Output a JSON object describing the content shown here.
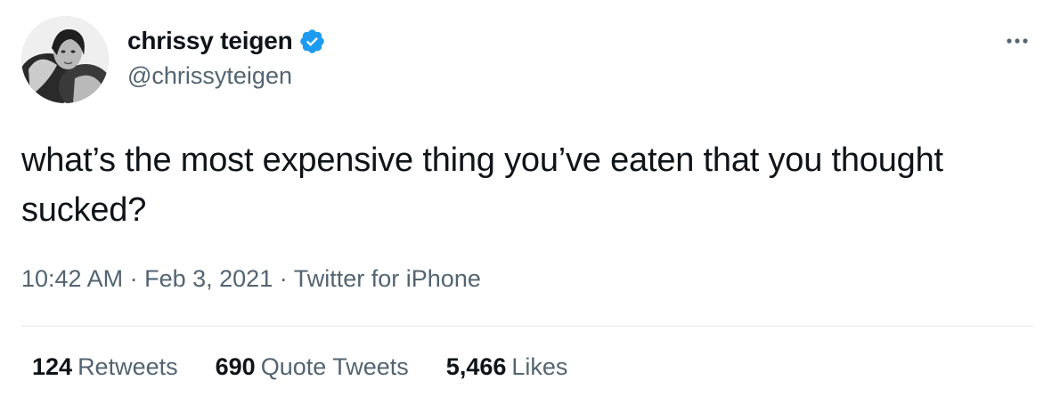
{
  "user": {
    "display_name": "chrissy teigen",
    "handle": "@chrissyteigen",
    "verified": true
  },
  "tweet": {
    "text": "what’s the most expensive thing you’ve eaten that you thought sucked?",
    "time": "10:42 AM",
    "date": "Feb 3, 2021",
    "source": "Twitter for iPhone",
    "separator": "·"
  },
  "stats": {
    "retweets_count": "124",
    "retweets_label": "Retweets",
    "quotes_count": "690",
    "quotes_label": "Quote Tweets",
    "likes_count": "5,466",
    "likes_label": "Likes"
  },
  "colors": {
    "text_primary": "#0f1419",
    "text_secondary": "#536471",
    "verified_blue": "#1d9bf0",
    "divider": "#e6e9eb"
  },
  "icons": {
    "verified": "verified-badge-icon",
    "more": "more-horizontal-icon"
  }
}
